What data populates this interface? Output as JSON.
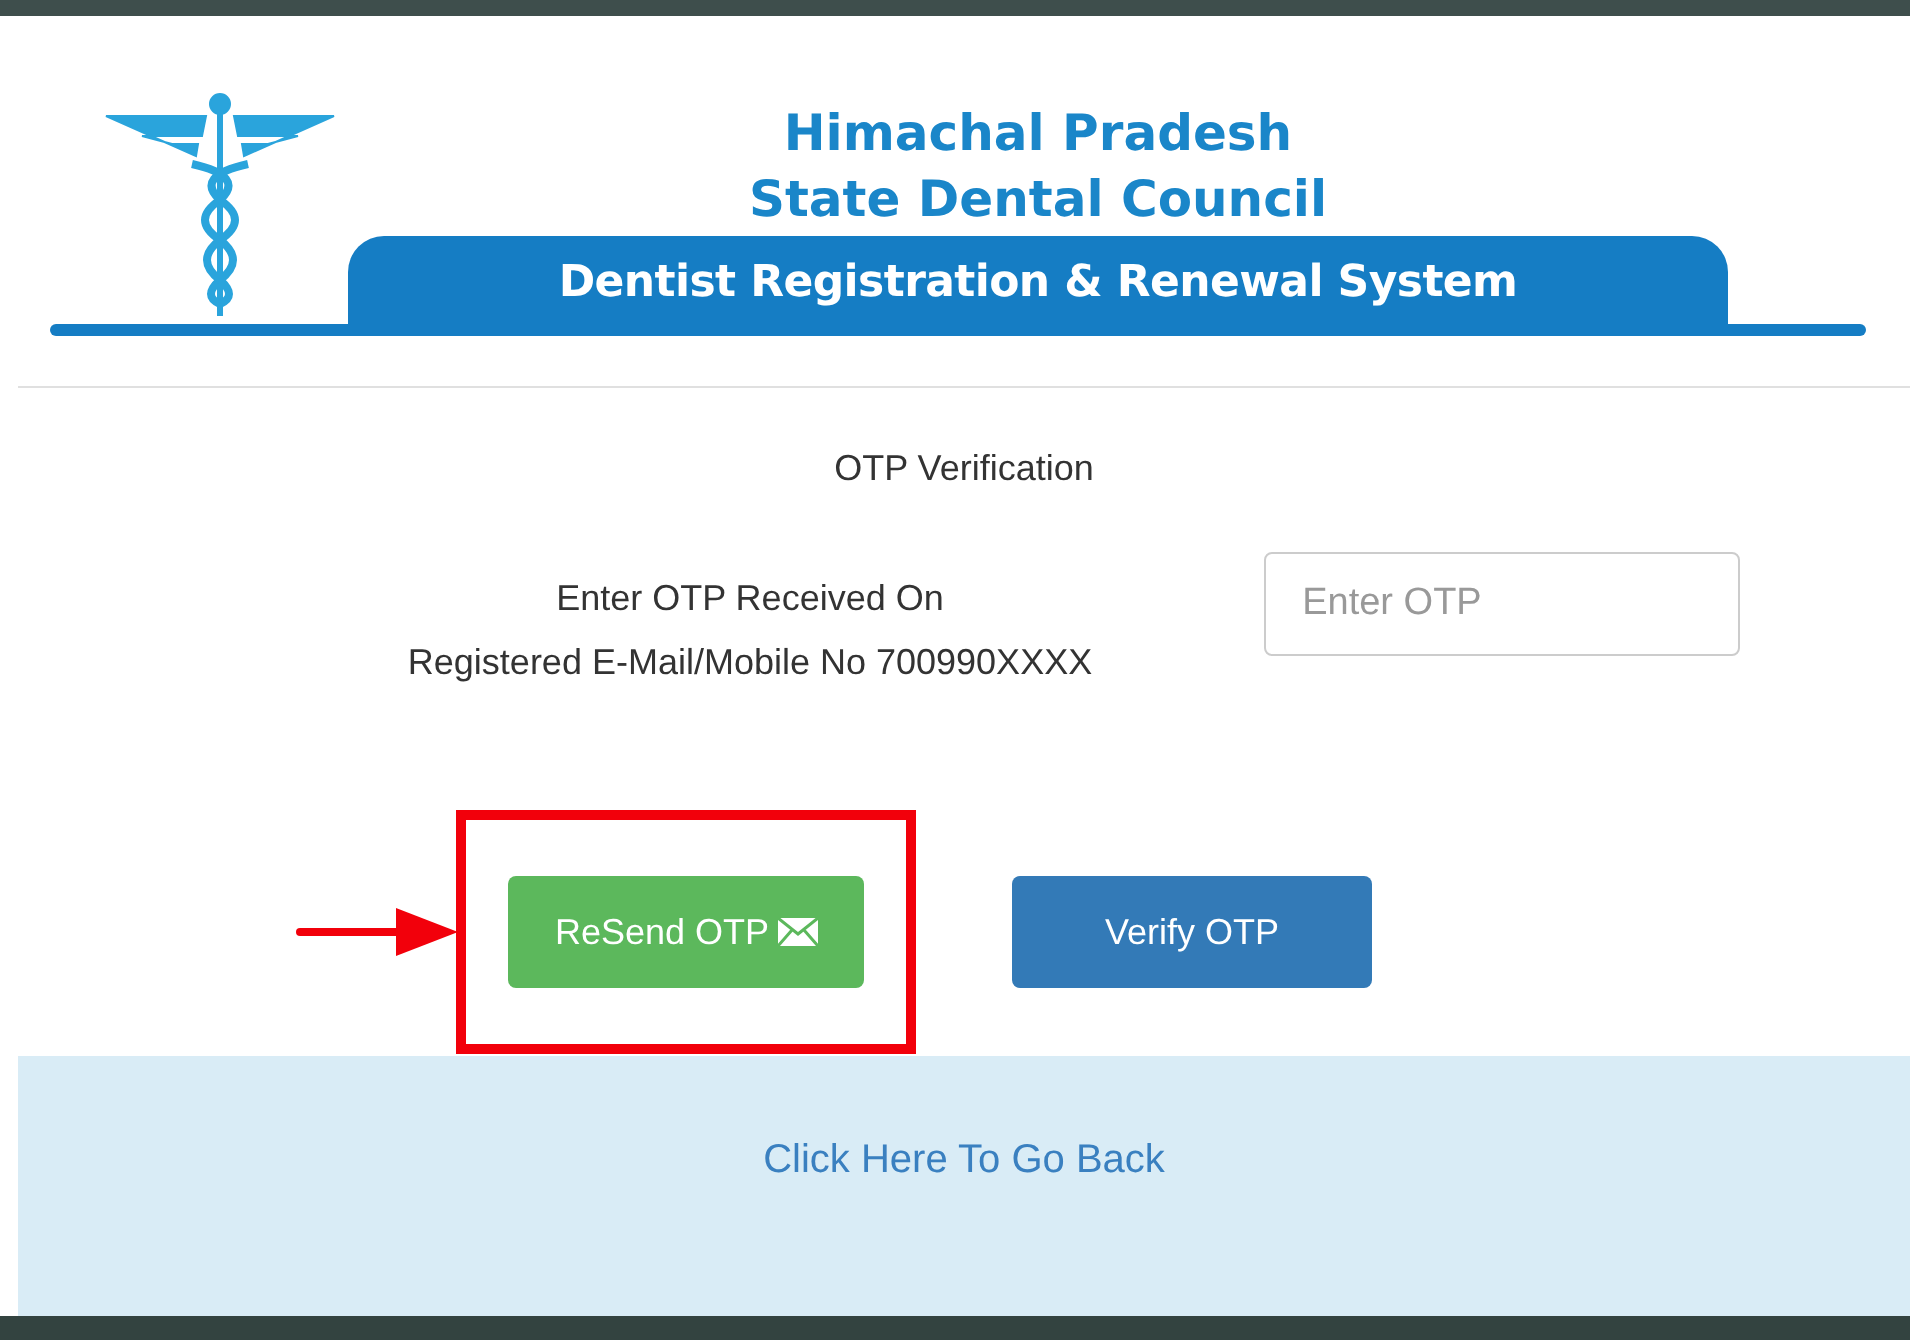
{
  "header": {
    "title_line_1": "Himachal Pradesh",
    "title_line_2": "State Dental Council",
    "banner": "Dentist Registration & Renewal System"
  },
  "form": {
    "heading": "OTP Verification",
    "prompt_line_1": "Enter OTP Received On",
    "prompt_line_2": "Registered E-Mail/Mobile No 700990XXXX",
    "otp_field": {
      "placeholder": "Enter OTP"
    }
  },
  "buttons": [
    {
      "kind": "resend",
      "label": "ReSend OTP",
      "highlighted": true
    },
    {
      "kind": "verify",
      "label": "Verify OTP",
      "highlighted": false
    }
  ],
  "footer": {
    "back_link": "Click Here To Go Back"
  }
}
